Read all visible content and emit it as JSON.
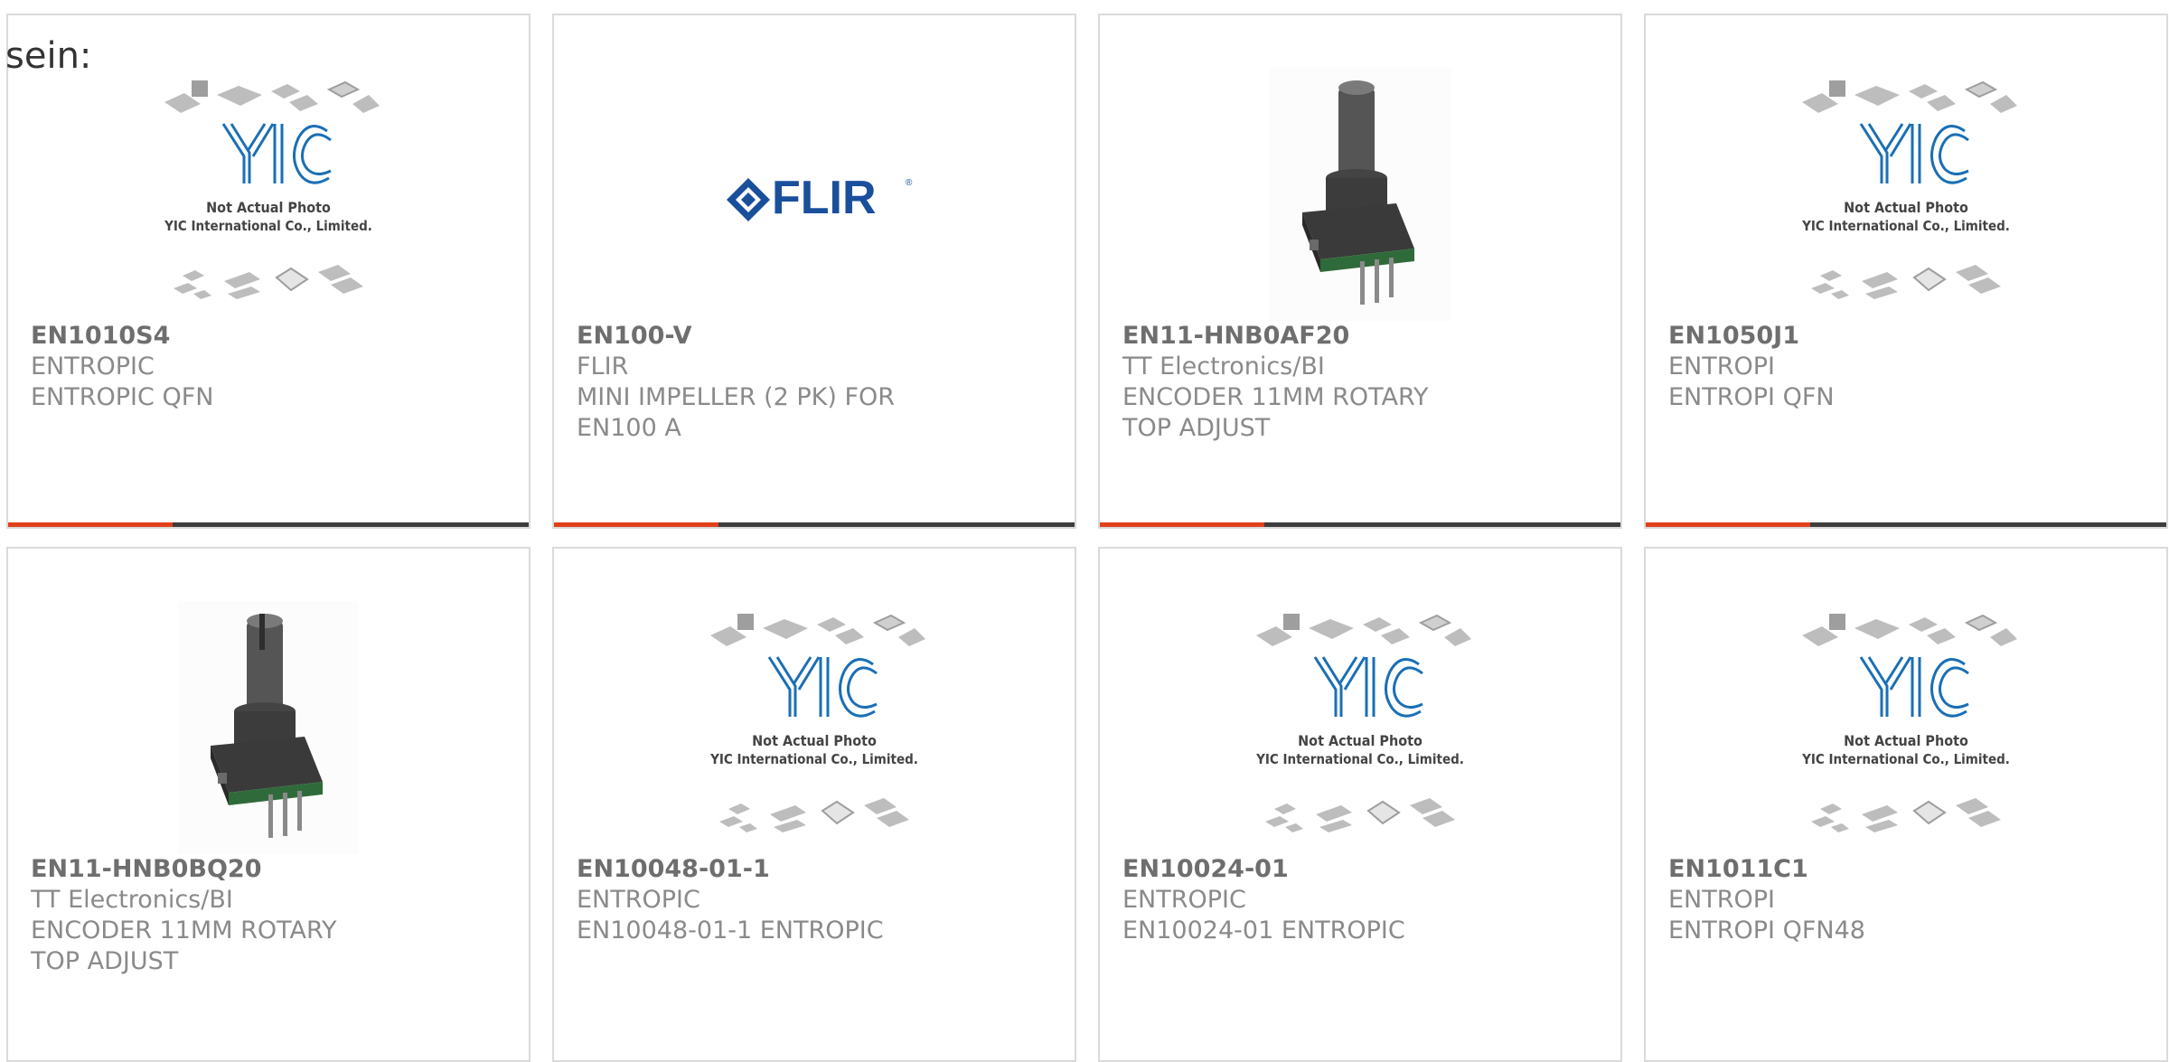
{
  "intro_text": "sein:",
  "placeholder": {
    "line1": "Not Actual Photo",
    "line2": "YIC International Co., Limited.",
    "logo_color": "#1a6fb5"
  },
  "flir_logo": {
    "text": "FLIR",
    "color": "#1a4f9c"
  },
  "accent_color": "#e0401a",
  "products": [
    {
      "part_number": "EN1010S4",
      "manufacturer": "ENTROPIC",
      "description": "ENTROPIC QFN",
      "image": "yic-placeholder"
    },
    {
      "part_number": "EN100-V",
      "manufacturer": "FLIR",
      "description": "MINI IMPELLER (2 PK) FOR EN100 A",
      "image": "flir-logo"
    },
    {
      "part_number": "EN11-HNB0AF20",
      "manufacturer": "TT Electronics/BI",
      "description": "ENCODER 11MM ROTARY TOP ADJUST",
      "image": "rotary-encoder"
    },
    {
      "part_number": "EN1050J1",
      "manufacturer": "ENTROPI",
      "description": "ENTROPI QFN",
      "image": "yic-placeholder"
    },
    {
      "part_number": "EN11-HNB0BQ20",
      "manufacturer": "TT Electronics/BI",
      "description": "ENCODER 11MM ROTARY TOP ADJUST",
      "image": "rotary-encoder-slotted"
    },
    {
      "part_number": "EN10048-01-1",
      "manufacturer": "ENTROPIC",
      "description": "EN10048-01-1 ENTROPIC",
      "image": "yic-placeholder"
    },
    {
      "part_number": "EN10024-01",
      "manufacturer": "ENTROPIC",
      "description": "EN10024-01 ENTROPIC",
      "image": "yic-placeholder"
    },
    {
      "part_number": "EN1011C1",
      "manufacturer": "ENTROPI",
      "description": "ENTROPI QFN48",
      "image": "yic-placeholder"
    }
  ]
}
